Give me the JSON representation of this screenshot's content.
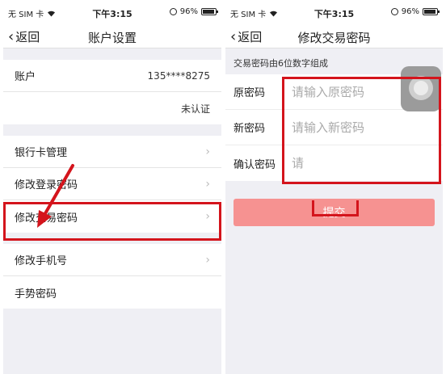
{
  "status_bar": {
    "carrier": "无 SIM 卡",
    "time": "下午3:15",
    "battery": "96%"
  },
  "left_screen": {
    "back_label": "返回",
    "title": "账户设置",
    "account": {
      "label": "账户",
      "value": "135****8275"
    },
    "verification_status": "未认证",
    "menu": [
      {
        "label": "银行卡管理"
      },
      {
        "label": "修改登录密码"
      },
      {
        "label": "修改交易密码"
      },
      {
        "label": "修改手机号"
      },
      {
        "label": "手势密码"
      }
    ]
  },
  "right_screen": {
    "back_label": "返回",
    "title": "修改交易密码",
    "hint": "交易密码由6位数字组成",
    "fields": [
      {
        "label": "原密码",
        "placeholder": "请输入原密码"
      },
      {
        "label": "新密码",
        "placeholder": "请输入新密码"
      },
      {
        "label": "确认密码",
        "placeholder": "请"
      }
    ],
    "submit_label": "提交"
  },
  "colors": {
    "highlight": "#d4141c",
    "submit_bg": "#f69291"
  }
}
